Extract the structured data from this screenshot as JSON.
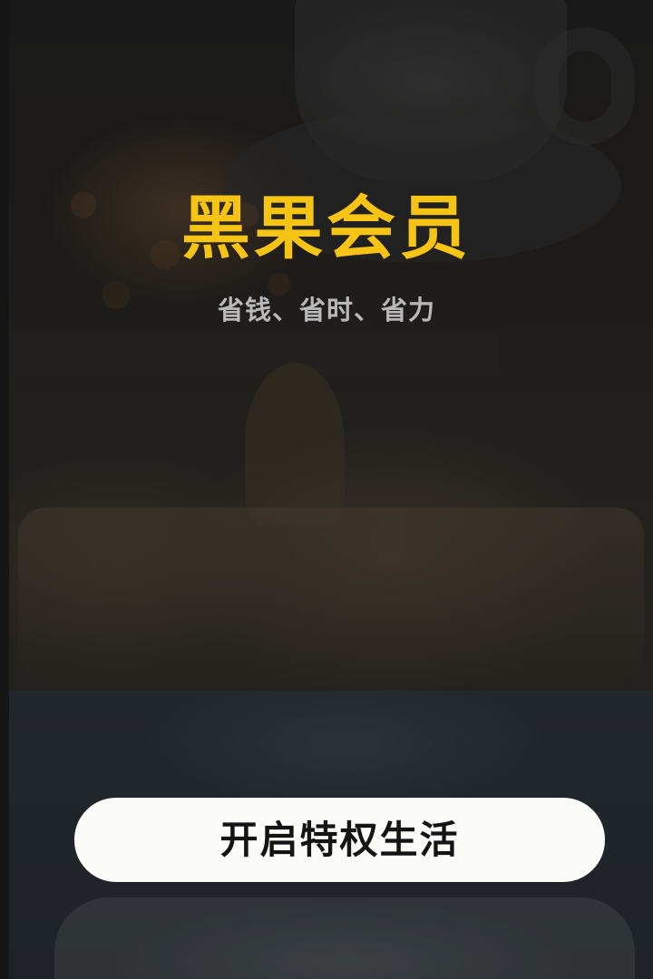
{
  "hero": {
    "title": "黑果会员",
    "subtitle": "省钱、省时、省力"
  },
  "cta": {
    "label": "开启特权生活"
  },
  "colors": {
    "title": "#f6c415",
    "subtitle": "#b9b9b9",
    "button_bg": "#fbfbf8",
    "button_text": "#141414"
  }
}
